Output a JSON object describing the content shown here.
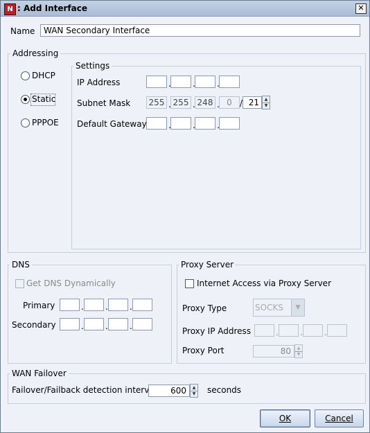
{
  "window": {
    "title": ": Add Interface",
    "app_icon_text": "N",
    "close_symbol": "✕"
  },
  "name_field": {
    "label": "Name",
    "value": "WAN Secondary Interfacе"
  },
  "addressing": {
    "legend": "Addressing",
    "modes": [
      {
        "label": "DHCP",
        "checked": false
      },
      {
        "label": "Static",
        "checked": true
      },
      {
        "label": "PPPOE",
        "checked": false
      }
    ],
    "settings": {
      "legend": "Settings",
      "ip_address": {
        "label": "IP Address",
        "octets": [
          "",
          "",
          "",
          ""
        ]
      },
      "subnet_mask": {
        "label": "Subnet Mask",
        "octets": [
          "255",
          "255",
          "248",
          "0"
        ],
        "separator": "/",
        "prefix": "21"
      },
      "default_gateway": {
        "label": "Default Gateway",
        "octets": [
          "",
          "",
          "",
          ""
        ]
      }
    }
  },
  "dns": {
    "legend": "DNS",
    "get_dynamic": {
      "label": "Get DNS Dynamically",
      "checked": false,
      "enabled": false
    },
    "primary": {
      "label": "Primary",
      "octets": [
        "",
        "",
        "",
        ""
      ]
    },
    "secondary": {
      "label": "Secondary",
      "octets": [
        "",
        "",
        "",
        ""
      ]
    }
  },
  "proxy": {
    "legend": "Proxy Server",
    "via_proxy": {
      "label": "Internet Access via Proxy Server",
      "checked": false
    },
    "type": {
      "label": "Proxy Type",
      "value": "SOCKS"
    },
    "ip": {
      "label": "Proxy IP Address",
      "octets": [
        "",
        "",
        "",
        ""
      ]
    },
    "port": {
      "label": "Proxy Port",
      "value": "80"
    }
  },
  "failover": {
    "legend": "WAN Failover",
    "interval_label": "Failover/Failback detection interval",
    "interval_value": "600",
    "unit": "seconds"
  },
  "buttons": {
    "ok": "OK",
    "cancel": "Cancel"
  },
  "dot_separator": ".",
  "spinner_up": "▲",
  "spinner_down": "▼",
  "combo_arrow": "▼"
}
